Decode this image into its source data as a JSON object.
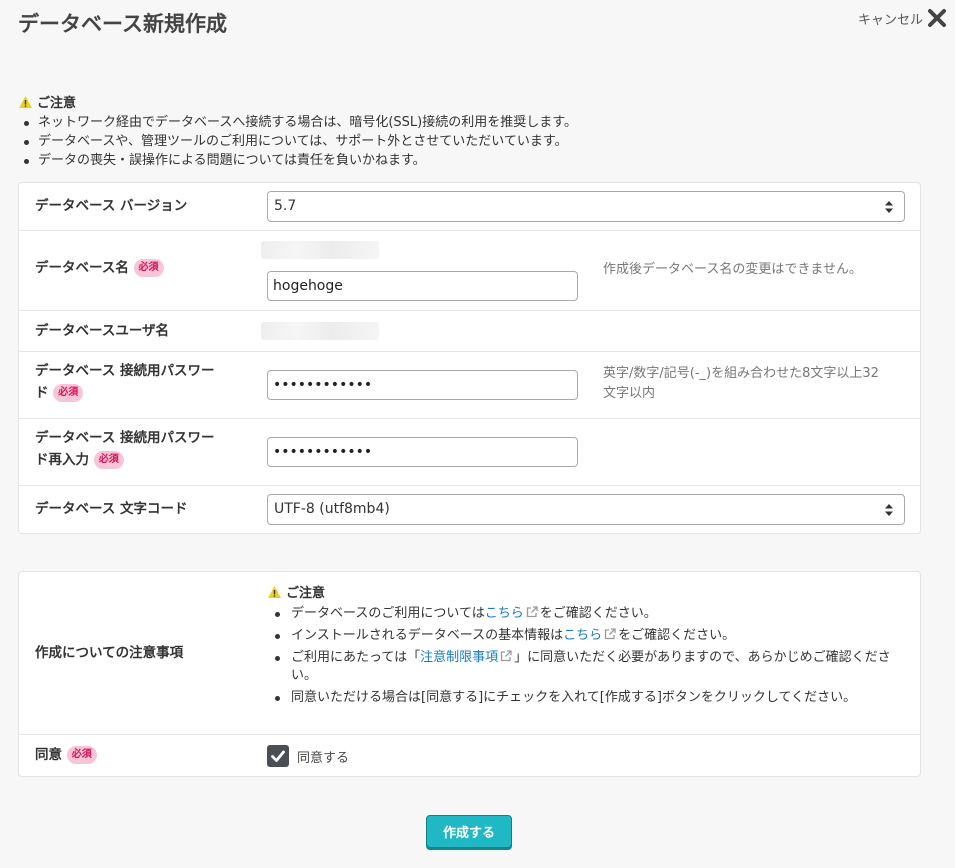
{
  "header": {
    "title": "データベース新規作成",
    "cancel_label": "キャンセル"
  },
  "top_notice": {
    "heading": "ご注意",
    "items": [
      "ネットワーク経由でデータベースへ接続する場合は、暗号化(SSL)接続の利用を推奨します。",
      "データベースや、管理ツールのご利用については、サポート外とさせていただいています。",
      "データの喪失・誤操作による問題については責任を負いかねます。"
    ]
  },
  "required_badge": "必須",
  "form": {
    "version": {
      "label": "データベース バージョン",
      "value": "5.7"
    },
    "db_name": {
      "label": "データベース名",
      "value": "hogehoge",
      "help": "作成後データベース名の変更はできません。"
    },
    "db_user": {
      "label": "データベースユーザ名"
    },
    "password": {
      "label_line1": "データベース 接続用パスワー",
      "label_line2": "ド",
      "value": "••••••••••••",
      "help_line1": "英字/数字/記号(-_)を組み合わせた8文字以上32",
      "help_line2": "文字以内"
    },
    "password_confirm": {
      "label_line1": "データベース 接続用パスワー",
      "label_line2": "ド再入力",
      "value": "••••••••••••"
    },
    "charset": {
      "label": "データベース 文字コード",
      "value": "UTF-8 (utf8mb4)"
    }
  },
  "notes": {
    "label": "作成についての注意事項",
    "heading": "ご注意",
    "item1_pre": "データベースのご利用については",
    "item1_link": "こちら",
    "item1_post": "をご確認ください。",
    "item2_pre": "インストールされるデータベースの基本情報は",
    "item2_link": "こちら",
    "item2_post": "をご確認ください。",
    "item3_pre": "ご利用にあたっては「",
    "item3_link": "注意制限事項",
    "item3_post": "」に同意いただく必要がありますので、あらかじめご確認ください。",
    "item4": "同意いただける場合は[同意する]にチェックを入れて[作成する]ボタンをクリックしてください。"
  },
  "agree": {
    "label": "同意",
    "checkbox_label": "同意する",
    "checked": true
  },
  "submit_label": "作成する"
}
